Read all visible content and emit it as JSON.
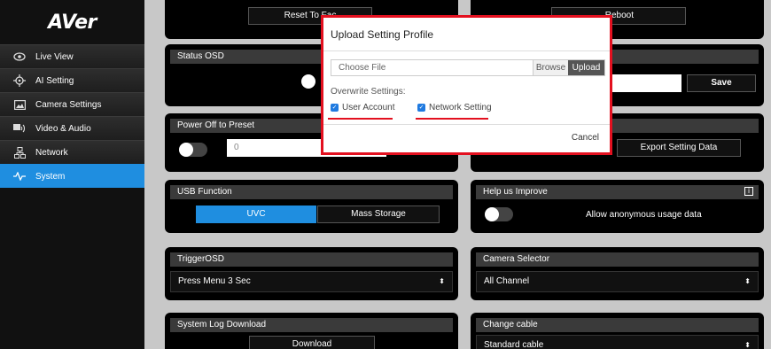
{
  "logo": "AVer",
  "sidebar": {
    "items": [
      {
        "label": "Live View",
        "icon": "eye-icon"
      },
      {
        "label": "AI Setting",
        "icon": "ai-target-icon"
      },
      {
        "label": "Camera Settings",
        "icon": "image-icon"
      },
      {
        "label": "Video & Audio",
        "icon": "video-audio-icon"
      },
      {
        "label": "Network",
        "icon": "network-icon"
      },
      {
        "label": "System",
        "icon": "pulse-icon",
        "active": true
      }
    ]
  },
  "main": {
    "reset_factory_label": "Reset To Fac",
    "reboot_label": "Reboot",
    "status_osd": {
      "title": "Status OSD"
    },
    "save_label": "Save",
    "power_off": {
      "title": "Power Off to Preset",
      "value": "0"
    },
    "export_label": "Export Setting Data",
    "usb": {
      "title": "USB Function",
      "options": [
        "UVC",
        "Mass Storage"
      ]
    },
    "help": {
      "title": "Help us Improve",
      "toggle_label": "Allow anonymous usage data"
    },
    "trigger_osd": {
      "title": "TriggerOSD",
      "value": "Press Menu 3 Sec"
    },
    "camera_selector": {
      "title": "Camera Selector",
      "value": "All Channel"
    },
    "system_log": {
      "title": "System Log Download",
      "button": "Download"
    },
    "change_cable": {
      "title": "Change cable",
      "value": "Standard cable"
    }
  },
  "modal": {
    "title": "Upload Setting Profile",
    "file_placeholder": "Choose File",
    "browse": "Browse",
    "upload": "Upload",
    "overwrite_label": "Overwrite Settings:",
    "checkbox_user": "User Account",
    "checkbox_network": "Network Setting",
    "cancel": "Cancel"
  },
  "colors": {
    "accent": "#1f8ee0",
    "highlight": "#e3101f"
  }
}
